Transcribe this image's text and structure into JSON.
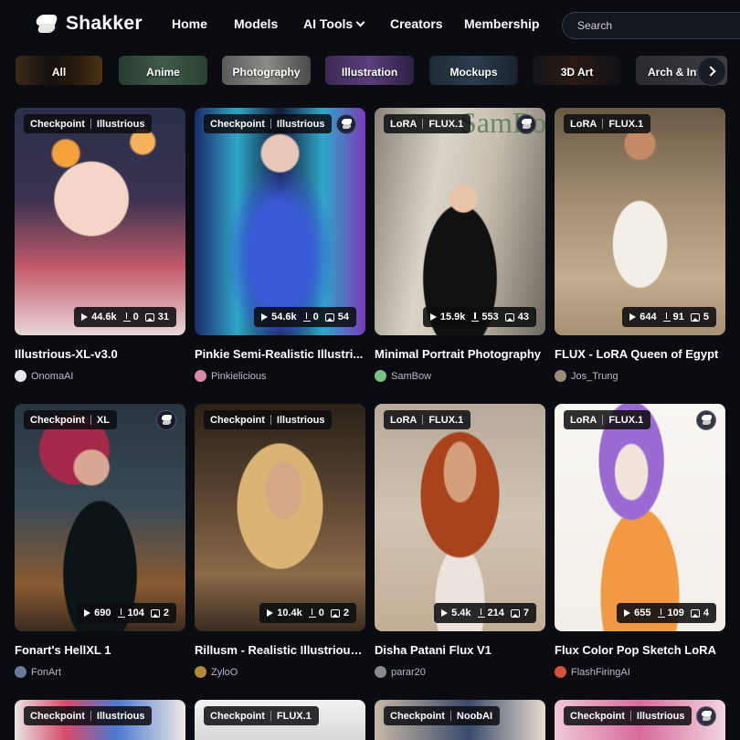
{
  "header": {
    "logo": "Shakker",
    "nav": [
      "Home",
      "Models",
      "AI Tools",
      "Creators",
      "Membership"
    ],
    "search_placeholder": "Search"
  },
  "categories": [
    "All",
    "Anime",
    "Photography",
    "Illustration",
    "Mockups",
    "3D Art",
    "Arch & Int"
  ],
  "cards": [
    {
      "tag1": "Checkpoint",
      "tag2": "Illustrious",
      "views": "44.6k",
      "downloads": "0",
      "images": "31",
      "title": "Illustrious-XL-v3.0",
      "author": "OnomaAI"
    },
    {
      "tag1": "Checkpoint",
      "tag2": "Illustrious",
      "views": "54.6k",
      "downloads": "0",
      "images": "54",
      "title": "Pinkie Semi-Realistic Illustri...",
      "author": "Pinkielicious"
    },
    {
      "tag1": "LoRA",
      "tag2": "FLUX.1",
      "views": "15.9k",
      "downloads": "553",
      "images": "43",
      "title": "Minimal Portrait Photography",
      "author": "SamBow"
    },
    {
      "tag1": "LoRA",
      "tag2": "FLUX.1",
      "views": "644",
      "downloads": "91",
      "images": "5",
      "title": "FLUX - LoRA Queen of Egypt",
      "author": "Jos_Trung"
    },
    {
      "tag1": "Checkpoint",
      "tag2": "XL",
      "views": "690",
      "downloads": "104",
      "images": "2",
      "title": "Fonart's HellXL 1",
      "author": "FonArt"
    },
    {
      "tag1": "Checkpoint",
      "tag2": "Illustrious",
      "views": "10.4k",
      "downloads": "0",
      "images": "2",
      "title": "Rillusm - Realistic Illustrious...",
      "author": "ZyloO"
    },
    {
      "tag1": "LoRA",
      "tag2": "FLUX.1",
      "views": "5.4k",
      "downloads": "214",
      "images": "7",
      "title": "Disha Patani Flux V1",
      "author": "parar20"
    },
    {
      "tag1": "LoRA",
      "tag2": "FLUX.1",
      "views": "655",
      "downloads": "109",
      "images": "4",
      "title": "Flux Color Pop Sketch LoRA",
      "author": "FlashFiringAI"
    },
    {
      "tag1": "Checkpoint",
      "tag2": "Illustrious"
    },
    {
      "tag1": "Checkpoint",
      "tag2": "FLUX.1"
    },
    {
      "tag1": "Checkpoint",
      "tag2": "NoobAI"
    },
    {
      "tag1": "Checkpoint",
      "tag2": "Illustrious"
    }
  ],
  "image_texts": {
    "sambow_watermark": "SamBow"
  }
}
